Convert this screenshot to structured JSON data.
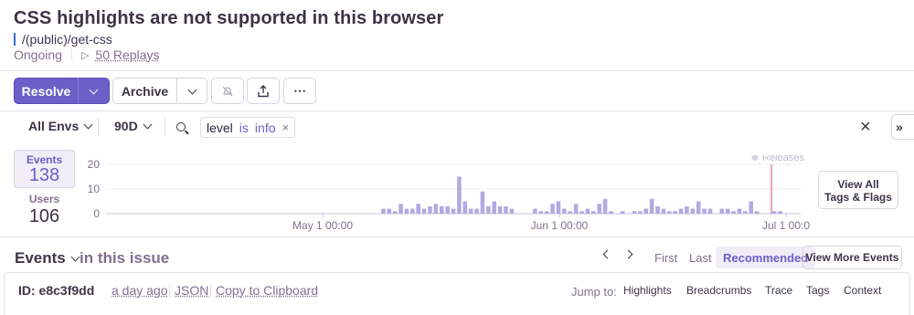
{
  "header": {
    "title": "CSS highlights are not supported in this browser",
    "culprit": "/(public)/get-css",
    "status": "Ongoing",
    "replays": "50 Replays"
  },
  "actions": {
    "resolve": "Resolve",
    "archive": "Archive",
    "more": "⋯"
  },
  "filters": {
    "environment": "All Envs",
    "period": "90D",
    "token_key": "level",
    "token_op": "is",
    "token_value": "info"
  },
  "stats": {
    "events_label": "Events",
    "events_count": "138",
    "users_label": "Users",
    "users_count": "106"
  },
  "chart_data": {
    "type": "bar",
    "x_tick_labels": [
      "May 1 00:00",
      "Jun 1 00:00",
      "Jul 1 00:0"
    ],
    "y_ticks": [
      0,
      10,
      20
    ],
    "ylim": [
      0,
      20
    ],
    "legend": "Releases",
    "legend_position": "top-right",
    "values": [
      0,
      0,
      0,
      0,
      0,
      0,
      0,
      0,
      0,
      0,
      0,
      0,
      0,
      0,
      0,
      0,
      0,
      0,
      0,
      0,
      0,
      0,
      0,
      0,
      0,
      0,
      0,
      0,
      0,
      0,
      0,
      0,
      0,
      0,
      0,
      0,
      0,
      0,
      0,
      0,
      0,
      0,
      0,
      0,
      0,
      0,
      0,
      2,
      2,
      1,
      4,
      2,
      2,
      4,
      2,
      3,
      4,
      3,
      3,
      2,
      15,
      5,
      2,
      2,
      9,
      3,
      5,
      3,
      3,
      2,
      0,
      0,
      0,
      2,
      1,
      1,
      4,
      5,
      2,
      1,
      4,
      1,
      2,
      1,
      4,
      6,
      1,
      0,
      1,
      0,
      1,
      1,
      2,
      6,
      3,
      2,
      1,
      1,
      2,
      3,
      2,
      5,
      2,
      2,
      0,
      2,
      2,
      1,
      2,
      1,
      5,
      1,
      0,
      0,
      1,
      1,
      0,
      0,
      0
    ]
  },
  "side": {
    "view_tags_line1": "View All",
    "view_tags_line2": "Tags & Flags"
  },
  "events_header": {
    "title": "Events",
    "subtitle": "in this issue",
    "first": "First",
    "last": "Last",
    "recommended": "Recommended",
    "view_more": "View More Events"
  },
  "event": {
    "id": "ID: e8c3f9dd",
    "time": "a day ago",
    "json": "JSON",
    "copy": "Copy to Clipboard",
    "jump_to": "Jump to:",
    "jump_links": [
      "Highlights",
      "Breadcrumbs",
      "Trace",
      "Tags",
      "Context"
    ]
  },
  "colors": {
    "accent": "#6c5fc7",
    "bar": "#b3a9e2",
    "release_line": "#e0418a"
  }
}
